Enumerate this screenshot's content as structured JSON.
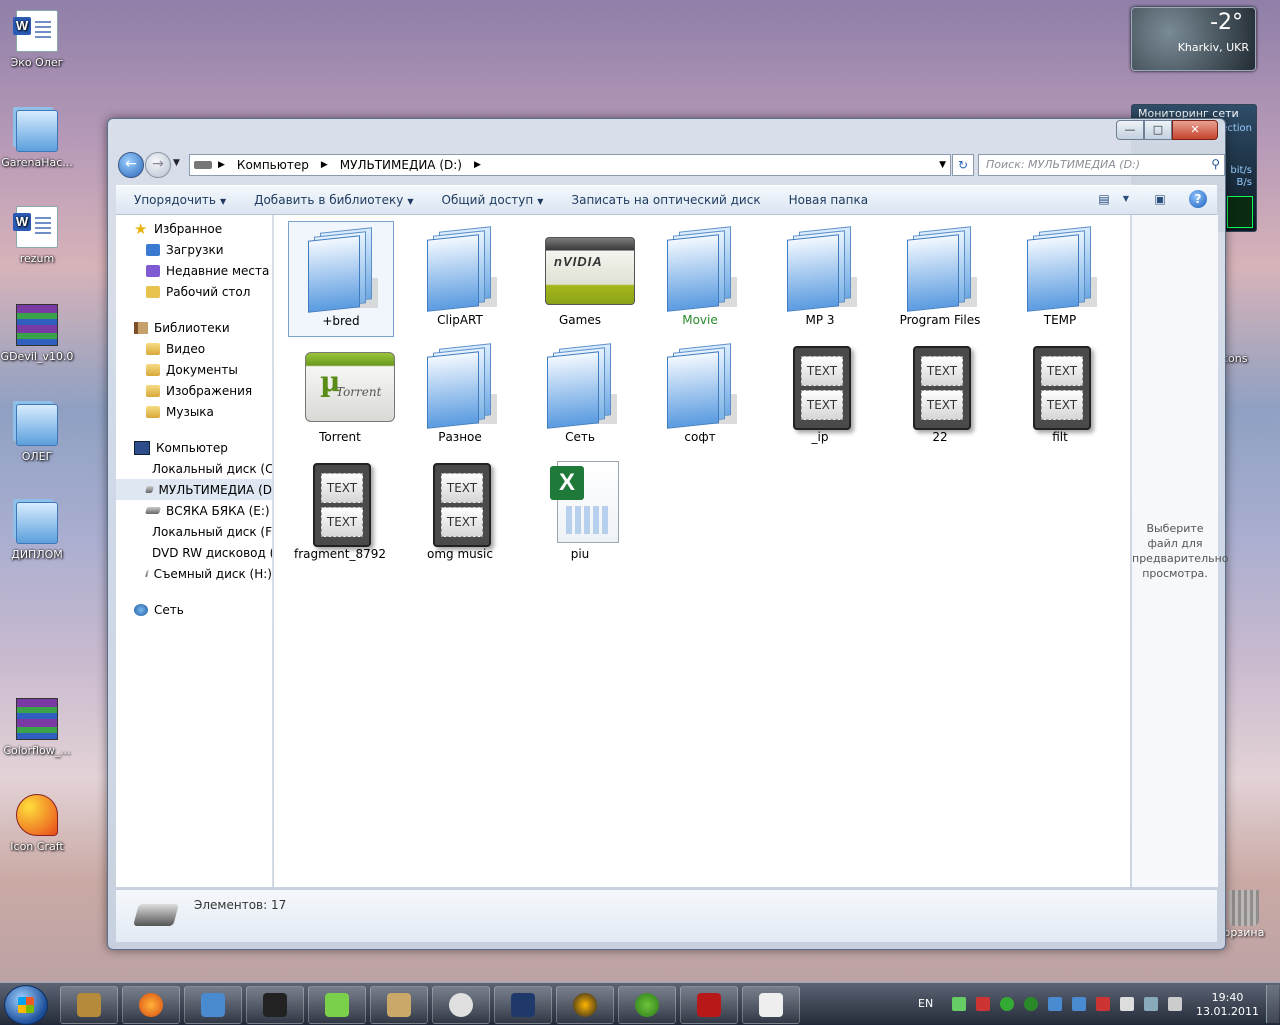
{
  "desktop": {
    "icons": [
      {
        "label": "Эко Олег",
        "icon": "word-document-icon"
      },
      {
        "label": "GarenaHac...",
        "icon": "folder-icon"
      },
      {
        "label": "rezum",
        "icon": "word-document-icon"
      },
      {
        "label": "GDevil_v10.0",
        "icon": "winrar-icon"
      },
      {
        "label": "ОЛЕГ",
        "icon": "folder-icon"
      },
      {
        "label": "ДИПЛОМ",
        "icon": "folder-icon"
      },
      {
        "label": "Colorflow_...",
        "icon": "winrar-icon"
      },
      {
        "label": "Icon Craft",
        "icon": "icon-craft-icon"
      }
    ],
    "right_partial_labels": [
      "cons",
      "орзина"
    ]
  },
  "gadgets": {
    "weather": {
      "temp": "-2°",
      "city": "Kharkiv, UKR"
    },
    "network": {
      "title": "Мониторинг сети",
      "line1": "ection",
      "line2": "bit/s",
      "line3": "B/s"
    }
  },
  "window": {
    "address": {
      "computer": "Компьютер",
      "drive": "МУЛЬТИМЕДИА (D:)"
    },
    "search_placeholder": "Поиск: МУЛЬТИМЕДИА (D:)",
    "toolbar": {
      "organize": "Упорядочить",
      "add_to_library": "Добавить в библиотеку",
      "share": "Общий доступ",
      "burn": "Записать на оптический диск",
      "new_folder": "Новая папка"
    },
    "nav": {
      "favorites": {
        "title": "Избранное",
        "items": [
          "Загрузки",
          "Недавние места",
          "Рабочий стол"
        ]
      },
      "libraries": {
        "title": "Библиотеки",
        "items": [
          "Видео",
          "Документы",
          "Изображения",
          "Музыка"
        ]
      },
      "computer": {
        "title": "Компьютер",
        "items": [
          "Локальный диск (C",
          "МУЛЬТИМЕДИА (D",
          "ВСЯКА БЯКА (E:)",
          "Локальный диск (F:",
          "DVD RW дисковод (",
          "Съемный диск (H:)"
        ]
      },
      "network": {
        "title": "Сеть"
      }
    },
    "items": [
      {
        "label": "+bred",
        "type": "folder"
      },
      {
        "label": "ClipART",
        "type": "folder"
      },
      {
        "label": "Games",
        "type": "nvidia-folder"
      },
      {
        "label": "Movie",
        "type": "folder"
      },
      {
        "label": "MP 3",
        "type": "folder"
      },
      {
        "label": "Program Files",
        "type": "folder"
      },
      {
        "label": "TEMP",
        "type": "folder"
      },
      {
        "label": "Torrent",
        "type": "torrent-folder"
      },
      {
        "label": "Разное",
        "type": "folder"
      },
      {
        "label": "Сеть",
        "type": "folder"
      },
      {
        "label": "софт",
        "type": "folder"
      },
      {
        "label": "_ip",
        "type": "text-file"
      },
      {
        "label": "22",
        "type": "text-file"
      },
      {
        "label": "filt",
        "type": "text-file"
      },
      {
        "label": "fragment_8792",
        "type": "text-file"
      },
      {
        "label": "omg music",
        "type": "text-file"
      },
      {
        "label": "piu",
        "type": "excel-file"
      }
    ],
    "text_icon_word": "TEXT",
    "nvidia_text": "nVIDIA",
    "torrent_text": "Torrent",
    "preview_lines": [
      "Выберите",
      "файл для",
      "предварительно",
      "просмотра."
    ],
    "status": "Элементов: 17"
  },
  "taskbar": {
    "lang": "EN",
    "time": "19:40",
    "date": "13.01.2011"
  }
}
